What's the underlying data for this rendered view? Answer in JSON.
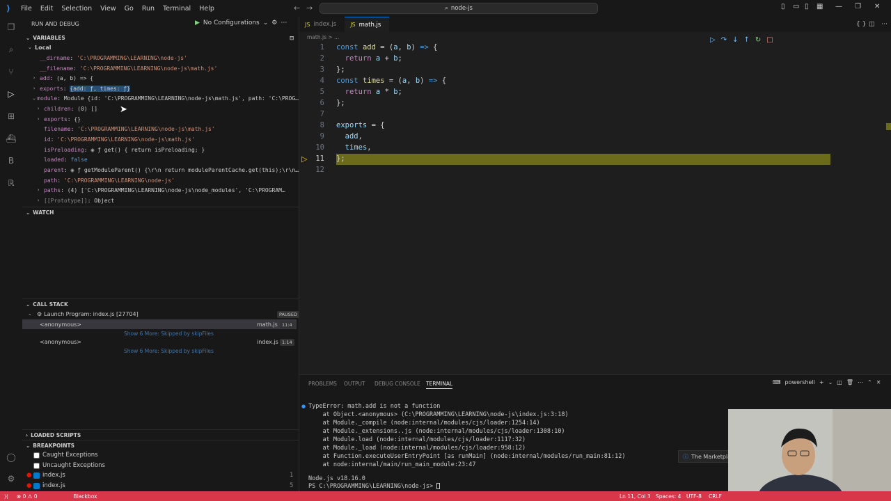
{
  "menu": [
    "File",
    "Edit",
    "Selection",
    "View",
    "Go",
    "Run",
    "Terminal",
    "Help"
  ],
  "command_center": "node-js",
  "sidebar": {
    "title": "RUN AND DEBUG",
    "config": "No Configurations",
    "variables_title": "VARIABLES",
    "local_title": "Local",
    "vars": [
      {
        "k": "__dirname",
        "v": "'C:\\PROGRAMMING\\LEARNING\\node-js'"
      },
      {
        "k": "__filename",
        "v": "'C:\\PROGRAMMING\\LEARNING\\node-js\\math.js'"
      },
      {
        "k": "add",
        "v": "(a, b) => {"
      },
      {
        "k": "exports",
        "v": "{add: ƒ, times: ƒ}"
      },
      {
        "k": "module",
        "v": "Module {id: 'C:\\PROGRAMMING\\LEARNING\\node-js\\math.js', path: 'C:\\PROG…"
      },
      {
        "k": "children",
        "v": "(0) []"
      },
      {
        "k": "exports",
        "v": "{}"
      },
      {
        "k": "filename",
        "v": "'C:\\PROGRAMMING\\LEARNING\\node-js\\math.js'"
      },
      {
        "k": "id",
        "v": "'C:\\PROGRAMMING\\LEARNING\\node-js\\math.js'"
      },
      {
        "k": "isPreloading",
        "v": "ƒ get() { return isPreloading; }"
      },
      {
        "k": "loaded",
        "v": "false"
      },
      {
        "k": "parent",
        "v": "ƒ getModuleParent() {\\r\\n  return moduleParentCache.get(this);\\r\\n…"
      },
      {
        "k": "path",
        "v": "'C:\\PROGRAMMING\\LEARNING\\node-js'"
      },
      {
        "k": "paths",
        "v": "(4) ['C:\\PROGRAMMING\\LEARNING\\node-js\\node_modules', 'C:\\PROGRAM…"
      },
      {
        "k": "[[Prototype]]",
        "v": "Object"
      }
    ],
    "watch_title": "WATCH",
    "callstack_title": "CALL STACK",
    "thread": "Launch Program: index.js [27704]",
    "paused": "PAUSED",
    "frames": [
      {
        "name": "<anonymous>",
        "file": "math.js",
        "pos": "11:4"
      },
      {
        "skip": "Show 6 More: Skipped by skipFiles"
      },
      {
        "name": "<anonymous>",
        "file": "index.js",
        "pos": "1:14"
      },
      {
        "skip": "Show 6 More: Skipped by skipFiles"
      }
    ],
    "loaded_scripts_title": "LOADED SCRIPTS",
    "breakpoints_title": "BREAKPOINTS",
    "breakpoints": [
      {
        "label": "Caught Exceptions",
        "checked": false,
        "num": ""
      },
      {
        "label": "Uncaught Exceptions",
        "checked": false,
        "num": ""
      },
      {
        "label": "index.js",
        "checked": true,
        "num": "1"
      },
      {
        "label": "index.js",
        "checked": true,
        "num": "5"
      }
    ]
  },
  "editor": {
    "tabs": [
      "index.js",
      "math.js"
    ],
    "breadcrumb": "math.js > ...",
    "lines": [
      "1",
      "2",
      "3",
      "4",
      "5",
      "6",
      "7",
      "8",
      "9",
      "10",
      "11",
      "12"
    ]
  },
  "panel": {
    "tabs": [
      "PROBLEMS",
      "OUTPUT",
      "DEBUG CONSOLE",
      "TERMINAL"
    ],
    "shell": "powershell",
    "terminal": [
      "TypeError: math.add is not a function",
      "    at Object.<anonymous> (C:\\PROGRAMMING\\LEARNING\\node-js\\index.js:3:18)",
      "    at Module._compile (node:internal/modules/cjs/loader:1254:14)",
      "    at Module._extensions..js (node:internal/modules/cjs/loader:1308:10)",
      "    at Module.load (node:internal/modules/cjs/loader:1117:32)",
      "    at Module._load (node:internal/modules/cjs/loader:958:12)",
      "    at Function.executeUserEntryPoint [as runMain] (node:internal/modules/run_main:81:12)",
      "    at node:internal/main/run_main_module:23:47",
      "",
      "Node.js v18.16.0",
      "PS C:\\PROGRAMMING\\LEARNING\\node-js> "
    ]
  },
  "notification": "The Marketplace",
  "status": {
    "left": "⊗ 0 ⚠ 0",
    "blackbox": "Blackbox",
    "position": "Ln 11, Col 3",
    "spaces": "Spaces: 4",
    "encoding": "UTF-8",
    "eol": "CRLF"
  }
}
